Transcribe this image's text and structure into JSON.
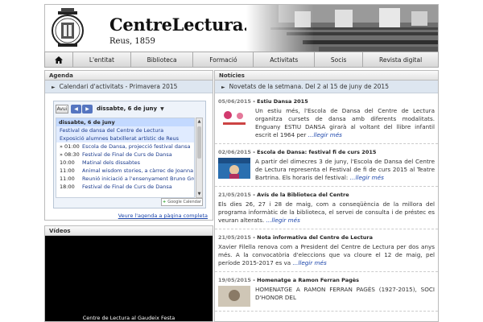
{
  "header": {
    "title": "CentreLectura.cat",
    "subtitle": "Reus, 1859"
  },
  "nav": {
    "home_icon": "home-icon",
    "items": [
      {
        "label": "L'entitat"
      },
      {
        "label": "Biblioteca"
      },
      {
        "label": "Formació"
      },
      {
        "label": "Activitats"
      },
      {
        "label": "Socis"
      },
      {
        "label": "Revista digital"
      }
    ]
  },
  "agenda": {
    "heading": "Agenda",
    "bar": "Calendari d'activitats - Primavera 2015",
    "today_button": "Avui",
    "current_date": "dissabte, 6 de juny",
    "day_header": "dissabte, 6 de juny",
    "events": [
      {
        "time": "",
        "title": "Festival de dansa del Centre de Lectura",
        "allday": true
      },
      {
        "time": "",
        "title": "Exposició alumnes batxillerat artístic de Reus",
        "allday": true
      },
      {
        "time": "» 01:00",
        "title": "Escola de Dansa, projecció festival dansa",
        "allday": false
      },
      {
        "time": "» 08:30",
        "title": "Festival de Final de Curs de Dansa",
        "allday": false
      },
      {
        "time": "10:00",
        "title": "Matinal dels dissabtes",
        "allday": false
      },
      {
        "time": "11:00",
        "title": "Animal wisdom stories, a càrrec de Joanna T",
        "allday": false
      },
      {
        "time": "11:00",
        "title": "Reunió iniciació a l'ensenyament Bruno Grön",
        "allday": false
      },
      {
        "time": "18:00",
        "title": "Festival de Final de Curs de Dansa",
        "allday": false
      }
    ],
    "gcal_label": "Google Calendar",
    "link": "Veure l'agenda a pàgina completa"
  },
  "videos": {
    "heading": "Vídeos",
    "caption": "Centre de Lectura al Gaudeix Festa"
  },
  "noticies": {
    "heading": "Notícies",
    "bar": "Novetats de la setmana. Del 2 al 15 de juny de 2015",
    "items": [
      {
        "date": "05/06/2015",
        "title": "Estiu Dansa 2015",
        "body": "Un estiu més, l'Escola de Dansa del Centre de Lectura organitza cursets de dansa amb diferents modalitats. Enguany ESTIU DANSA girarà al voltant del llibre infantil escrit el 1964 per ",
        "more": "...llegir més",
        "has_thumb": true
      },
      {
        "date": "02/06/2015",
        "title": "Escola de Dansa: festival fi de curs 2015",
        "body": " A partir del dimecres 3 de juny, l'Escola de Dansa del Centre de Lectura representa el Festival de fi de curs 2015 al Teatre Bartrina. Els horaris del festival: ",
        "more": "...llegir més",
        "has_thumb": true
      },
      {
        "date": "21/05/2015",
        "title": "Avís de la Biblioteca del Centre",
        "body": "Els dies 26, 27 i 28 de maig, com a conseqüència de la millora del programa informàtic de la biblioteca, el servei de consulta i de préstec es veuran alterats. ",
        "more": "...llegir més",
        "has_thumb": false
      },
      {
        "date": "21/05/2015",
        "title": "Nota informativa del Centre de Lectura",
        "body": "Xavier Filella renova com a President del Centre de Lectura per dos anys més. A la convocatòria d'eleccions que va cloure el 12 de maig, pel període 2015-2017 es va ",
        "more": "...llegir més",
        "has_thumb": false
      },
      {
        "date": "19/05/2015",
        "title": "Homenatge a Ramon Ferran Pagès",
        "body": "HOMENATGE A RAMON FERRAN PAGÈS (1927-2015), SOCI D'HONOR DEL",
        "more": "",
        "has_thumb": true
      }
    ]
  },
  "colors": {
    "bar_blue": "#dde6f0",
    "link_blue": "#1a44aa",
    "calendar_arrow": "#5575c0"
  }
}
